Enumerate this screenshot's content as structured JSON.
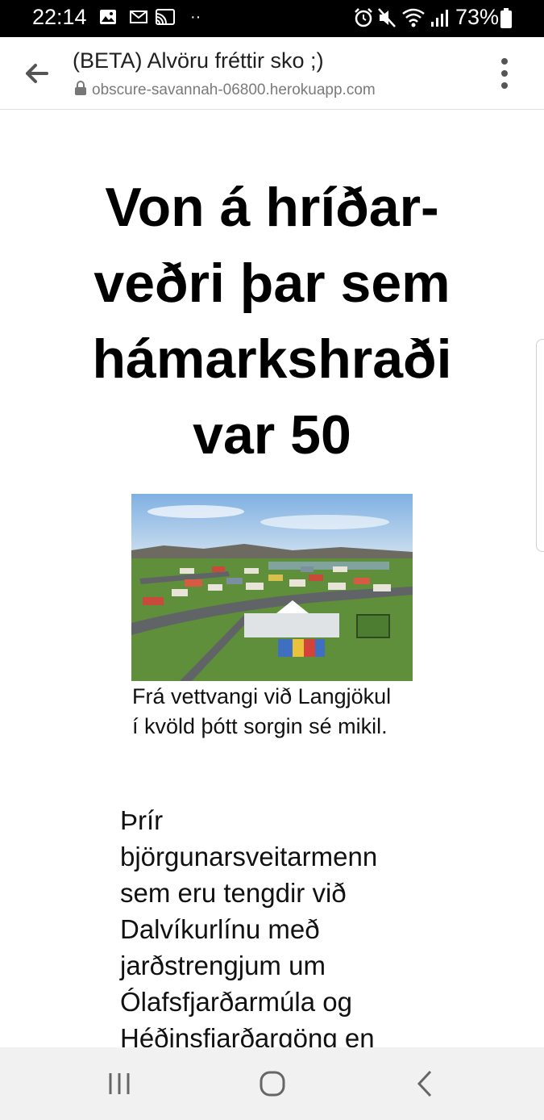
{
  "status_bar": {
    "time": "22:14",
    "battery": "73%",
    "icons": [
      "image-icon",
      "mail-icon",
      "cast-icon",
      "dots-icon",
      "alarm-icon",
      "mute-icon",
      "wifi-icon",
      "signal-icon",
      "battery-icon"
    ]
  },
  "browser": {
    "title": "(BETA) Alvöru fréttir sko ;)",
    "url": "obscure-savannah-06800.herokuapp.com"
  },
  "article": {
    "headline": "Von á hríðar-veðri þar sem hámarkshraði var 50",
    "caption": "Frá vettvangi við Langjökul í kvöld þótt sorgin sé mikil.",
    "body": "Þrír björgunarsveitarmenn sem eru tengdir við Dalvíkurlínu með jarðstrengjum um Ólafsfjarðarmúla og Héðinsfjarðargöng en"
  },
  "colors": {
    "status_bar_bg": "#000000",
    "nav_bar_bg": "#f1f1f1",
    "grass": "#5f8f3a",
    "sky": "#9fc3e8"
  }
}
